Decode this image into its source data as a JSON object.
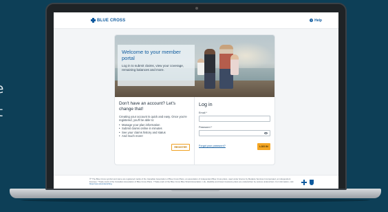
{
  "background": {
    "fragments": [
      "e",
      "t"
    ],
    "color": "#0d3f57"
  },
  "header": {
    "logo_text": "BLUE CROSS",
    "help_label": "Help"
  },
  "hero": {
    "title": "Welcome to your member portal",
    "subtitle": "Log in to submit claims, view your coverage, remaining balances and more."
  },
  "register": {
    "heading": "Don't have an account? Let's change that!",
    "intro": "Creating your account is quick and easy. Once you're registered, you'll be able to:",
    "benefits": [
      "Manage your plan information",
      "Submit claims online in minutes",
      "See your claims history and status",
      "And much more!"
    ],
    "button_label": "REGISTER"
  },
  "login": {
    "heading": "Log in",
    "email_label": "Email *",
    "email_value": "",
    "password_label": "Password *",
    "password_value": "",
    "forgot_label": "Forgot your password?",
    "button_label": "LOG IN"
  },
  "footer": {
    "legal_text": "®* The Blue Cross symbol and name are registered marks of the Canadian Association of Blue Cross Plans, an association of independent Blue Cross plans, used under licence by Medavie Services Incorporated, an independent licensee. *Trade-mark of the Canadian Association of Blue Cross Plans. †Trade-mark of the Blue Cross Blue Shield Association. Life, disability and travel insurance plans are underwritten by various underwriters. For information, visit",
    "link_text": "bluecross.ca/underwriting"
  },
  "colors": {
    "brand_blue": "#0d5a9e",
    "accent_orange": "#f5a623"
  }
}
